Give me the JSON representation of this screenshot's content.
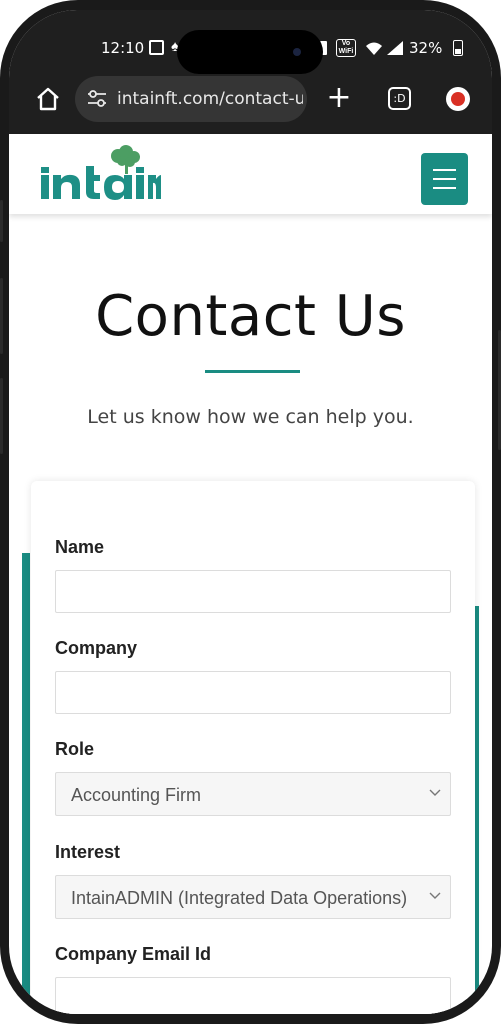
{
  "status": {
    "time": "12:10",
    "volte": "Vo WiFi",
    "battery": "32%"
  },
  "browser": {
    "url": "intainft.com/contact-u",
    "tabs_count": ":D"
  },
  "header": {
    "logo_text": "intain",
    "brand_color": "#1a8c82"
  },
  "hero": {
    "title": "Contact Us",
    "subtitle": "Let us know how we can help you."
  },
  "form": {
    "name_label": "Name",
    "name_value": "",
    "company_label": "Company",
    "company_value": "",
    "role_label": "Role",
    "role_selected": "Accounting Firm",
    "interest_label": "Interest",
    "interest_selected": "IntainADMIN (Integrated Data Operations)",
    "email_label": "Company Email Id"
  }
}
